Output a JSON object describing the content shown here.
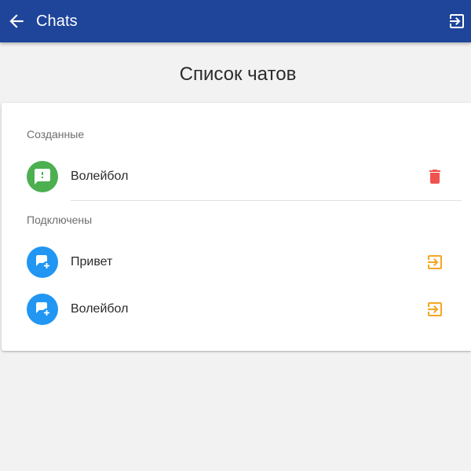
{
  "toolbar": {
    "back_icon": "arrow-back-icon",
    "title": "Chats",
    "exit_icon": "exit-to-app-icon",
    "background": "#1e459a"
  },
  "page": {
    "title": "Список чатов"
  },
  "sections": {
    "created": {
      "label": "Созданные",
      "items": [
        {
          "name": "Волейбол",
          "avatar_icon": "chat-alert-icon",
          "avatar_color": "#4caf50",
          "action_icon": "delete-icon",
          "action_color": "#ef5350"
        }
      ]
    },
    "connected": {
      "label": "Подключены",
      "items": [
        {
          "name": "Привет",
          "avatar_icon": "chat-add-icon",
          "avatar_color": "#2196f3",
          "action_icon": "exit-to-app-icon",
          "action_color": "#f5a623"
        },
        {
          "name": "Волейбол",
          "avatar_icon": "chat-add-icon",
          "avatar_color": "#2196f3",
          "action_icon": "exit-to-app-icon",
          "action_color": "#f5a623"
        }
      ]
    }
  }
}
